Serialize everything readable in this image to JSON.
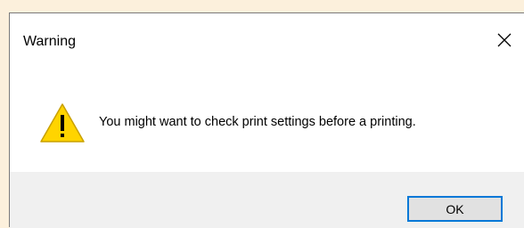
{
  "window": {
    "title": "Warning",
    "close_icon": "close-icon"
  },
  "content": {
    "icon": "warning-icon",
    "message": "You might want to check print settings before a printing."
  },
  "buttons": {
    "ok_label": "OK"
  },
  "colors": {
    "backdrop": "#FCF0DC",
    "dialog_body": "#FFFFFF",
    "footer": "#F0F0F0",
    "warning_fill": "#FFD400",
    "focus_border": "#0078D7"
  }
}
